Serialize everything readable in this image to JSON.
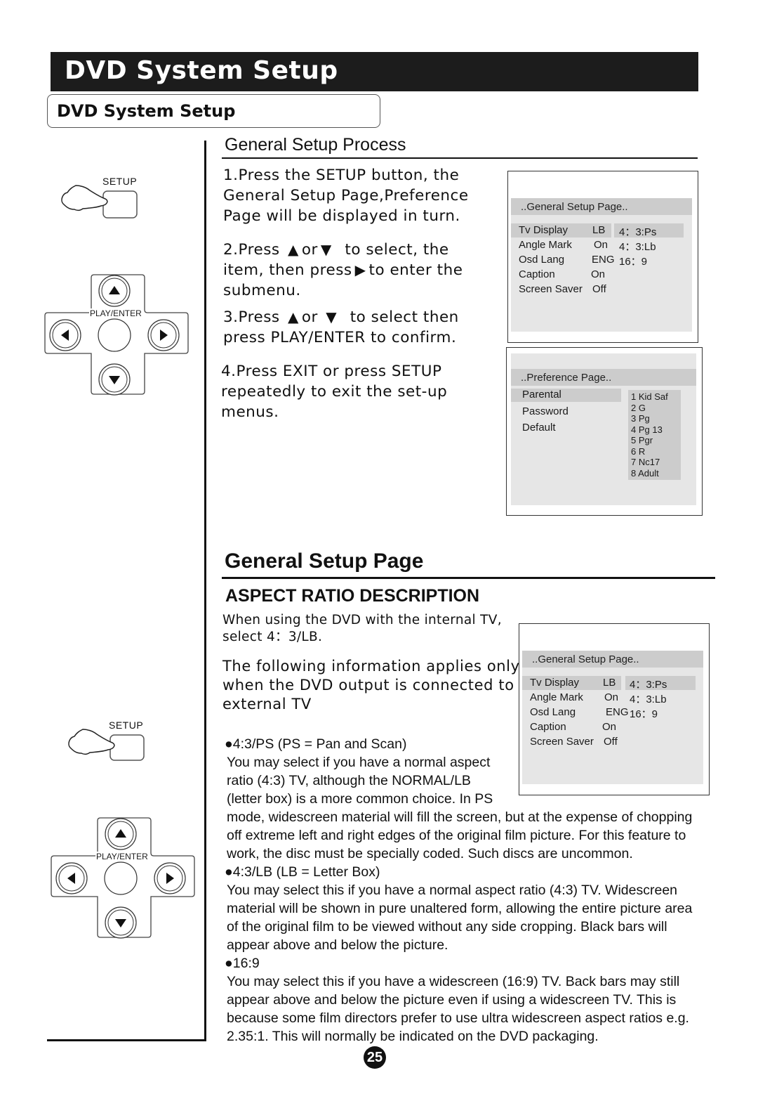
{
  "header": {
    "title": "DVD System Setup",
    "subtitle": "DVD System Setup"
  },
  "process": {
    "heading": "General Setup Process",
    "steps": [
      {
        "lines": [
          "1.Press the SETUP button, the",
          "General Setup Page,Preference",
          "Page  will be displayed in turn."
        ]
      },
      {
        "line1_pre": "2.Press",
        "line1_or": "or",
        "line1_post": "to select, the",
        "line2_pre": "item, then press",
        "line2_post": "to enter the",
        "line3": "submenu."
      },
      {
        "line1_pre": "3.Press",
        "line1_or": "or",
        "line1_post": "to select then",
        "line2": "press PLAY/ENTER to confirm."
      },
      {
        "lines": [
          "4.Press EXIT or press SETUP",
          "repeatedly  to exit  the  set-up",
          "menus."
        ]
      }
    ]
  },
  "remote": {
    "setup_label": "SETUP",
    "play_enter_label": "PLAY/ENTER"
  },
  "osd_general": {
    "title": "..General Setup Page..",
    "rows": [
      {
        "label": "Tv Display",
        "value": "LB",
        "option": "4：3:Ps"
      },
      {
        "label": "Angle Mark",
        "value": "On",
        "option": "4：3:Lb"
      },
      {
        "label": "Osd Lang",
        "value": "ENG",
        "option": "16：9"
      },
      {
        "label": "Caption",
        "value": "On",
        "option": ""
      },
      {
        "label": "Screen Saver",
        "value": "Off",
        "option": ""
      }
    ]
  },
  "osd_preference": {
    "title": "..Preference Page..",
    "items": [
      "Parental",
      "Password",
      "Default"
    ],
    "ratings": [
      "1 Kid Saf",
      "2 G",
      "3 Pg",
      "4 Pg 13",
      "5 Pgr",
      "6 R",
      "7 Nc17",
      "8 Adult"
    ]
  },
  "general_page": {
    "heading": "General Setup Page",
    "subheading": "ASPECT RATIO DESCRIPTION",
    "intro_lines": [
      "When using the DVD with the internal TV,",
      "select 4：3/LB."
    ],
    "external_lines": [
      "The following information applies only",
      "when the DVD output is connected to an",
      "external TV"
    ],
    "options": [
      {
        "title": "4:3/PS (PS = Pan and Scan)",
        "lines": [
          "You may select if you have a normal aspect",
          "ratio (4:3) TV, although the NORMAL/LB",
          "(letter box) is a more common choice. In PS",
          "mode, widescreen material will fill the screen, but at the expense of chopping",
          "off extreme left and right edges of the original film picture. For this feature to",
          "work, the disc must be specially coded. Such discs are uncommon."
        ]
      },
      {
        "title": "4:3/LB (LB = Letter Box)",
        "lines": [
          "You may select this if you have a normal aspect ratio (4:3) TV. Widescreen",
          "material will be shown in pure unaltered form, allowing the entire picture area",
          "of the original film to be viewed without any side cropping. Black bars will",
          "appear above and below the picture."
        ]
      },
      {
        "title": "16:9",
        "lines": [
          "You may select this if you have a widescreen (16:9) TV. Back bars may still",
          "appear above and below the picture even if using a widescreen TV. This is",
          "because some film directors prefer to use ultra widescreen aspect ratios e.g.",
          "2.35:1. This will normally be indicated on the DVD packaging."
        ]
      }
    ]
  },
  "footer": {
    "page_number": "25"
  }
}
